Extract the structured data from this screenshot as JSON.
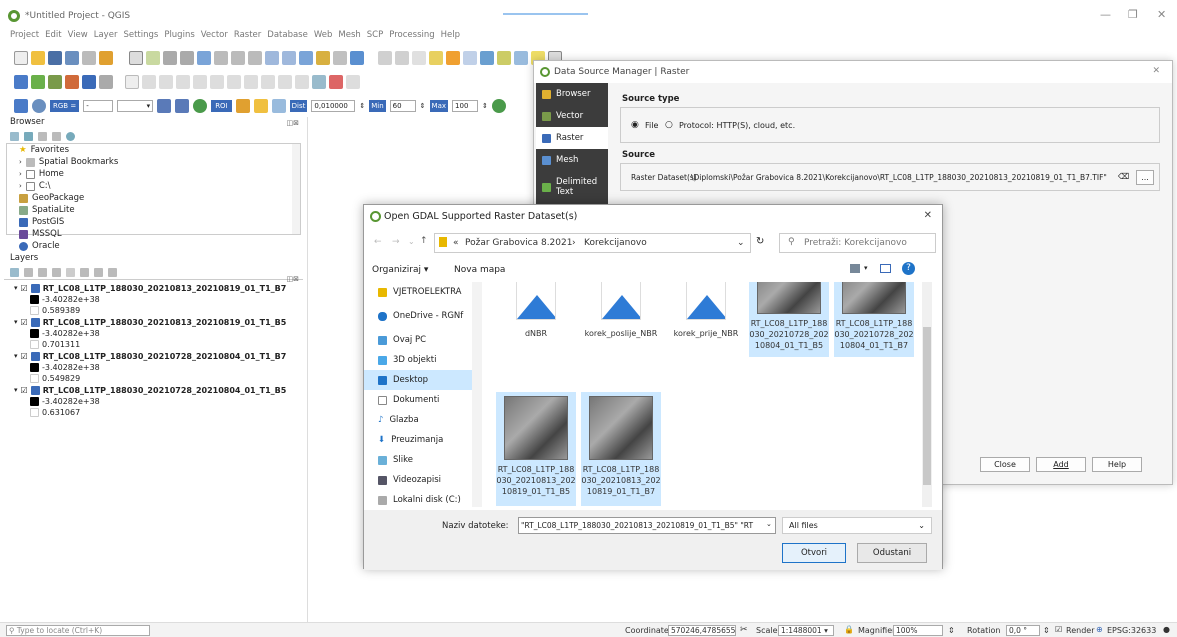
{
  "window": {
    "title": "*Untitled Project - QGIS"
  },
  "menu": [
    "Project",
    "Edit",
    "View",
    "Layer",
    "Settings",
    "Plugins",
    "Vector",
    "Raster",
    "Database",
    "Web",
    "Mesh",
    "SCP",
    "Processing",
    "Help"
  ],
  "toolbar3": {
    "rgb_label": "RGB =",
    "rgb_value": "-",
    "roi_label": "ROI",
    "dist_label": "Dist",
    "dist_value": "0,010000",
    "min_label": "Min",
    "min_value": "60",
    "max_label": "Max",
    "max_value": "100"
  },
  "browser": {
    "title": "Browser",
    "items": [
      "Favorites",
      "Spatial Bookmarks",
      "Home",
      "C:\\",
      "GeoPackage",
      "SpatiaLite",
      "PostGIS",
      "MSSQL",
      "Oracle"
    ]
  },
  "layers": {
    "title": "Layers",
    "items": [
      {
        "name": "RT_LC08_L1TP_188030_20210813_20210819_01_T1_B7",
        "min": "-3.40282e+38",
        "max": "0.589389"
      },
      {
        "name": "RT_LC08_L1TP_188030_20210813_20210819_01_T1_B5",
        "min": "-3.40282e+38",
        "max": "0.701311"
      },
      {
        "name": "RT_LC08_L1TP_188030_20210728_20210804_01_T1_B7",
        "min": "-3.40282e+38",
        "max": "0.549829"
      },
      {
        "name": "RT_LC08_L1TP_188030_20210728_20210804_01_T1_B5",
        "min": "-3.40282e+38",
        "max": "0.631067"
      }
    ]
  },
  "status": {
    "locate_placeholder": "Type to locate (Ctrl+K)",
    "coordinate_label": "Coordinate",
    "coordinate_value": "570246,4785655",
    "scale_label": "Scale",
    "scale_value": "1:1488001",
    "magnifier_label": "Magnifier",
    "magnifier_value": "100%",
    "rotation_label": "Rotation",
    "rotation_value": "0,0 °",
    "render_label": "Render",
    "epsg": "EPSG:32633"
  },
  "dsm": {
    "title": "Data Source Manager | Raster",
    "side": [
      "Browser",
      "Vector",
      "Raster",
      "Mesh",
      "Delimited Text"
    ],
    "source_type_label": "Source type",
    "opt_file": "File",
    "opt_protocol": "Protocol: HTTP(S), cloud, etc.",
    "source_label": "Source",
    "raster_label": "Raster Dataset(s)",
    "raster_value": "\\Diplomski\\Požar Grabovica 8.2021\\Korekcijanovo\\RT_LC08_L1TP_188030_20210813_20210819_01_T1_B7.TIF\"",
    "browse": "...",
    "close": "Close",
    "add": "Add",
    "help": "Help"
  },
  "gdal": {
    "title": "Open GDAL Supported Raster Dataset(s)",
    "path_prefix": "«",
    "path1": "Požar Grabovica 8.2021",
    "path_sep": "›",
    "path2": "Korekcijanovo",
    "search_placeholder": "Pretraži: Korekcijanovo",
    "organize": "Organiziraj ▾",
    "new_folder": "Nova mapa",
    "nav": [
      "VJETROELEKTRA",
      "OneDrive - RGNf",
      "Ovaj PC",
      "3D objekti",
      "Desktop",
      "Dokumenti",
      "Glazba",
      "Preuzimanja",
      "Slike",
      "Videozapisi",
      "Lokalni disk (C:)"
    ],
    "files": [
      "dNBR",
      "korek_poslije_NBR",
      "korek_prije_NBR",
      "RT_LC08_L1TP_188030_20210728_20210804_01_T1_B5",
      "RT_LC08_L1TP_188030_20210728_20210804_01_T1_B7",
      "RT_LC08_L1TP_188030_20210813_20210819_01_T1_B5",
      "RT_LC08_L1TP_188030_20210813_20210819_01_T1_B7"
    ],
    "filename_label": "Naziv datoteke:",
    "filename_value": "\"RT_LC08_L1TP_188030_20210813_20210819_01_T1_B5\" \"RT",
    "filter": "All files",
    "open": "Otvori",
    "cancel": "Odustani"
  }
}
